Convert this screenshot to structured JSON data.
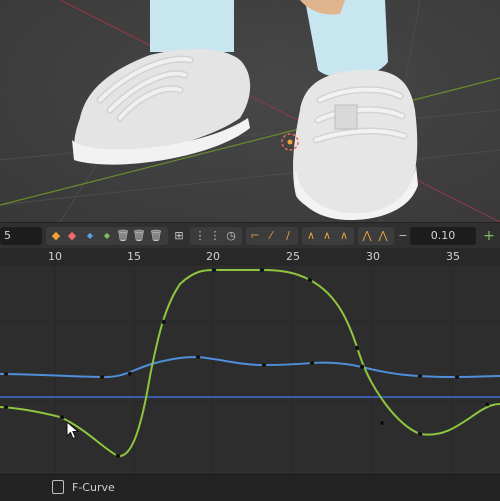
{
  "toolbar": {
    "frame_value": "5",
    "add_value": "0.10",
    "plus_icon": "plus-icon",
    "minus_icon": "minus-icon"
  },
  "ruler": {
    "labels": [
      "10",
      "15",
      "20",
      "25",
      "30",
      "35"
    ]
  },
  "status": {
    "editor_label": "F-Curve",
    "editor_icon": "f-curve-icon"
  },
  "colors": {
    "green_curve": "#8cc63f",
    "blue_curve": "#4f8ed8",
    "flat_line": "#3f6fd6",
    "background": "#2d2d2d"
  }
}
